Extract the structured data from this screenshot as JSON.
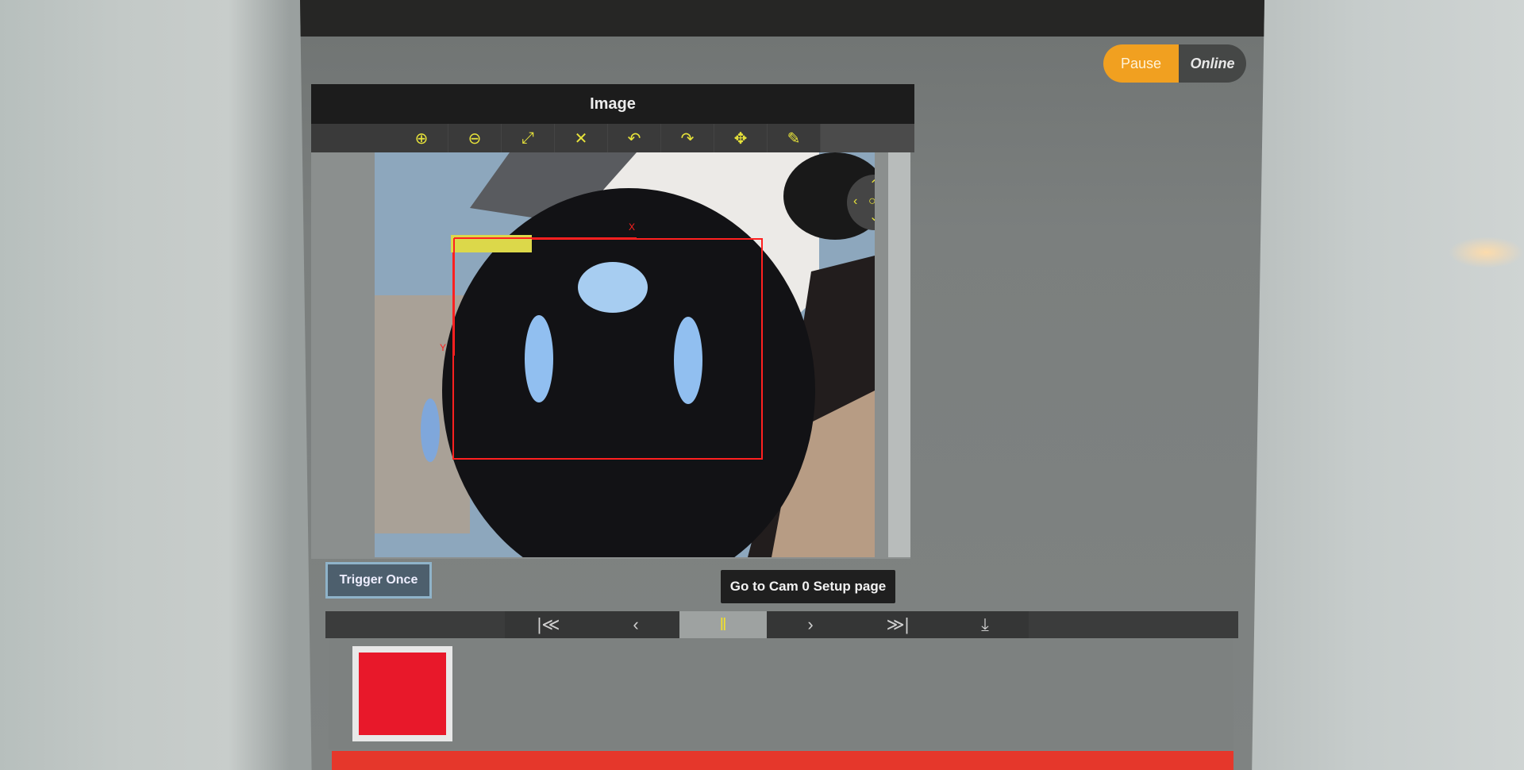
{
  "app": {
    "mode_toggle": {
      "pause_label": "Pause",
      "online_label": "Online",
      "active": "Pause"
    },
    "image_panel": {
      "title": "Image",
      "tools": [
        {
          "name": "zoom-in-icon",
          "glyph": "⊕"
        },
        {
          "name": "zoom-out-icon",
          "glyph": "⊖"
        },
        {
          "name": "fit-diagonal-icon",
          "glyph": "⤢"
        },
        {
          "name": "fit-screen-icon",
          "glyph": "✕"
        },
        {
          "name": "rotate-left-icon",
          "glyph": "↶"
        },
        {
          "name": "rotate-right-icon",
          "glyph": "↷"
        },
        {
          "name": "pan-icon",
          "glyph": "✥"
        },
        {
          "name": "picker-icon",
          "glyph": "✎"
        }
      ]
    },
    "roi": {
      "x_axis_label": "X",
      "y_axis_label": "Y"
    },
    "buttons": {
      "trigger": "Trigger Once",
      "setup": "Go to Cam 0 Setup page"
    },
    "playback": [
      {
        "name": "first-frame-icon",
        "glyph": "|≪"
      },
      {
        "name": "previous-frame-icon",
        "glyph": "‹"
      },
      {
        "name": "pause-icon",
        "glyph": "‖",
        "active": true
      },
      {
        "name": "next-frame-icon",
        "glyph": "›"
      },
      {
        "name": "last-frame-icon",
        "glyph": "≫|"
      },
      {
        "name": "download-icon",
        "glyph": "⤓"
      }
    ],
    "status": {
      "result_color": "#e8182a"
    }
  }
}
